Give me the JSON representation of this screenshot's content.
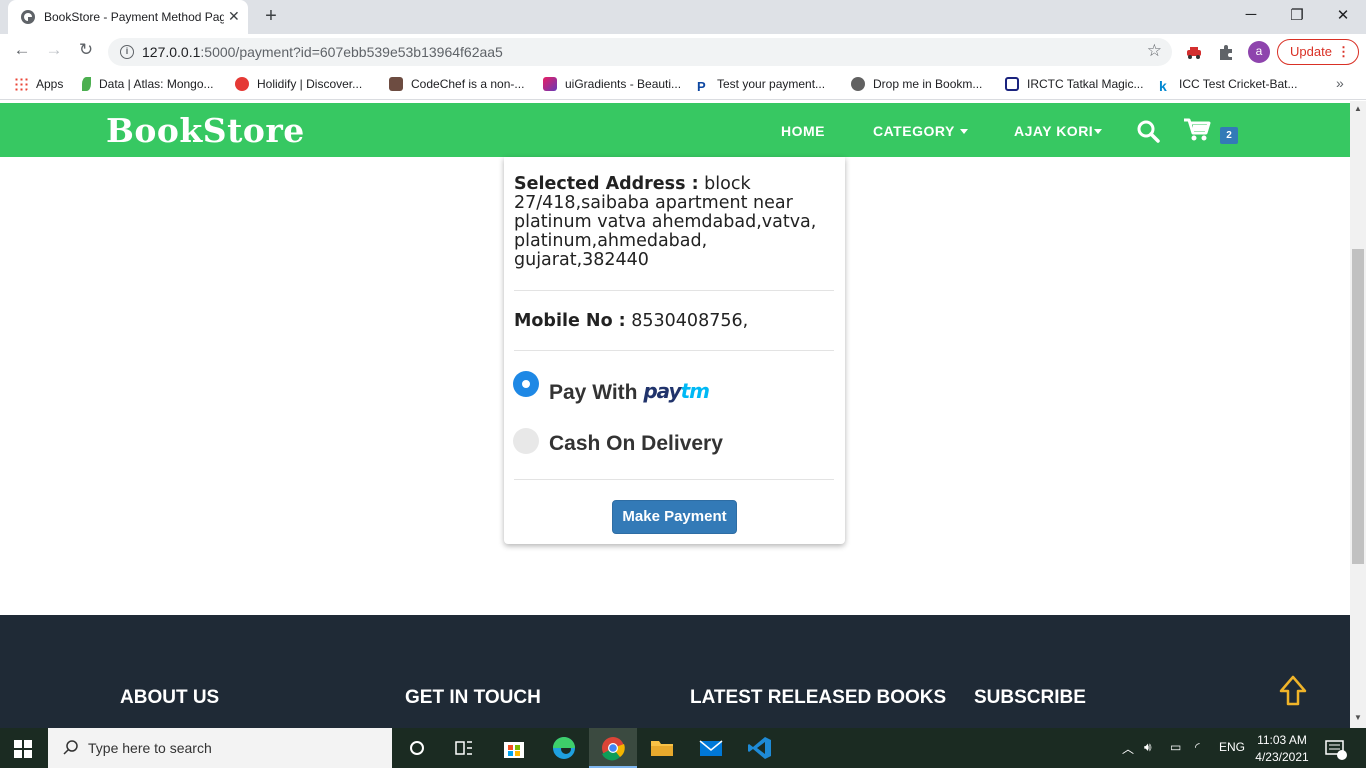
{
  "browser": {
    "tab_title": "BookStore - Payment Method Page",
    "url_host": "127.0.0.1",
    "url_rest": ":5000/payment?id=607ebb539e53b13964f62aa5",
    "avatar_letter": "a",
    "update_label": "Update"
  },
  "bookmarks": [
    {
      "label": "Apps",
      "color": "#ea4335"
    },
    {
      "label": "Data | Atlas: Mongo...",
      "color": "#4caf50"
    },
    {
      "label": "Holidify | Discover...",
      "color": "#e53935"
    },
    {
      "label": "CodeChef is a non-...",
      "color": "#6d4c41"
    },
    {
      "label": "uiGradients - Beauti...",
      "color": "#9c27b0"
    },
    {
      "label": "Test your payment...",
      "color": "#0d47a1"
    },
    {
      "label": "Drop me in Bookm...",
      "color": "#616161"
    },
    {
      "label": "IRCTC Tatkal Magic...",
      "color": "#1a237e"
    },
    {
      "label": "ICC Test Cricket-Bat...",
      "color": "#0288d1"
    }
  ],
  "navbar": {
    "logo": "BookStore",
    "home": "HOME",
    "category": "CATEGORY",
    "user": "AJAY KORI",
    "cart_count": "2"
  },
  "payment": {
    "address_label": "Selected Address :",
    "address_value": "block 27/418,saibaba apartment near platinum vatva ahemdabad,vatva, platinum,ahmedabad, gujarat,382440",
    "mobile_label": "Mobile No :",
    "mobile_value": "8530408756,",
    "option_paytm_prefix": "Pay With",
    "paytm_logo_a": "pay",
    "paytm_logo_b": "tm",
    "option_cod": "Cash On Delivery",
    "selected_option": "paytm",
    "make_payment": "Make Payment"
  },
  "footer": {
    "about": "ABOUT US",
    "contact": "GET IN TOUCH",
    "latest": "LATEST RELEASED BOOKS",
    "subscribe": "SUBSCRIBE"
  },
  "taskbar": {
    "search_placeholder": "Type here to search",
    "language": "ENG",
    "time": "11:03 AM",
    "date": "4/23/2021"
  },
  "colors": {
    "navbar_green": "#37c862",
    "button_blue": "#337ab7",
    "radio_blue": "#1e88e5",
    "footer_dark": "#1f2a36"
  }
}
